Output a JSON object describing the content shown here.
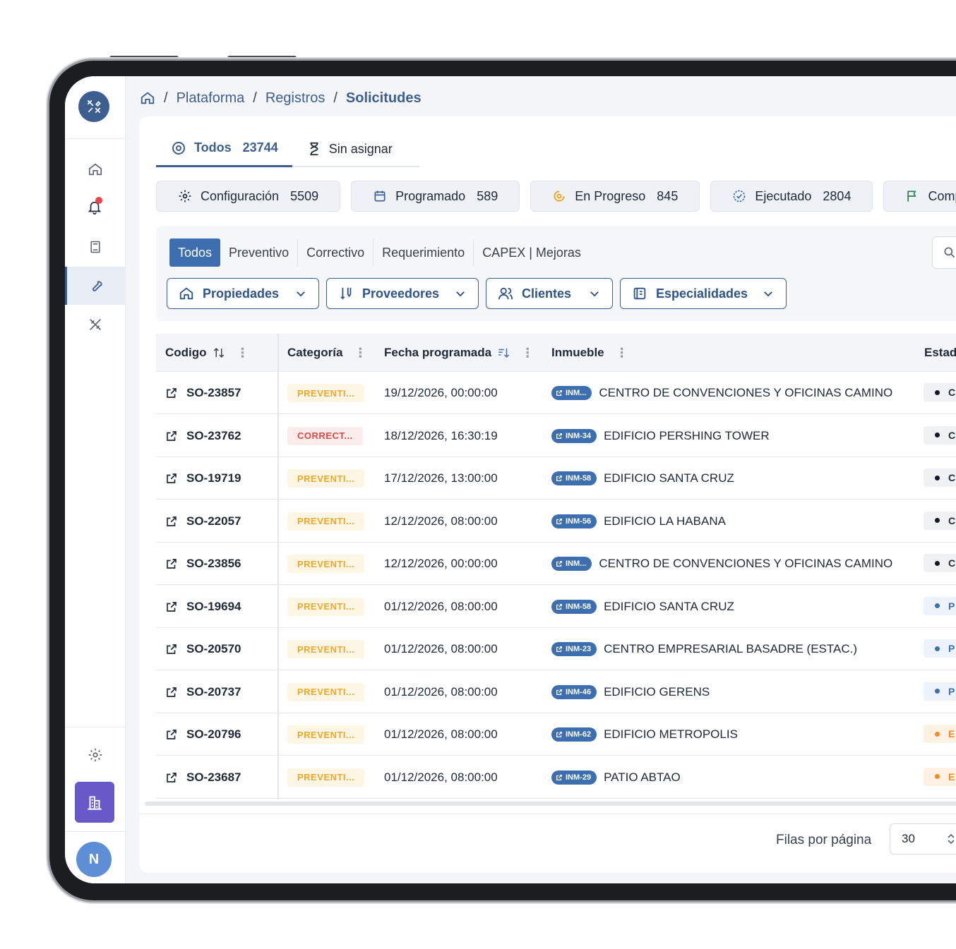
{
  "breadcrumb": {
    "items": [
      "Plataforma",
      "Registros"
    ],
    "current": "Solicitudes"
  },
  "tabs": [
    {
      "label": "Todos",
      "count": "23744"
    },
    {
      "label": "Sin asignar"
    }
  ],
  "status_chips": [
    {
      "label": "Configuración",
      "count": "5509",
      "icon": "gear-icon"
    },
    {
      "label": "Programado",
      "count": "589",
      "icon": "calendar-icon"
    },
    {
      "label": "En Progreso",
      "count": "845",
      "icon": "progress-icon"
    },
    {
      "label": "Ejecutado",
      "count": "2804",
      "icon": "check-circle-icon"
    },
    {
      "label": "Comp",
      "icon": "flag-icon"
    }
  ],
  "segments": [
    "Todos",
    "Preventivo",
    "Correctivo",
    "Requerimiento",
    "CAPEX | Mejoras"
  ],
  "dropdowns": [
    "Propiedades",
    "Proveedores",
    "Clientes",
    "Especialidades"
  ],
  "table": {
    "headers": {
      "code": "Codigo",
      "category": "Categoría",
      "date": "Fecha programada",
      "property": "Inmueble",
      "status": "Estad"
    },
    "rows": [
      {
        "code": "SO-23857",
        "category": "PREVENTI...",
        "cat_type": "prev",
        "date": "19/12/2026, 00:00:00",
        "inm": "INM...",
        "property": "CENTRO DE CONVENCIONES Y OFICINAS CAMINO",
        "state": "C",
        "state_color": "gray"
      },
      {
        "code": "SO-23762",
        "category": "CORRECT...",
        "cat_type": "corr",
        "date": "18/12/2026, 16:30:19",
        "inm": "INM-34",
        "property": "EDIFICIO PERSHING TOWER",
        "state": "C",
        "state_color": "gray"
      },
      {
        "code": "SO-19719",
        "category": "PREVENTI...",
        "cat_type": "prev",
        "date": "17/12/2026, 13:00:00",
        "inm": "INM-58",
        "property": "EDIFICIO SANTA CRUZ",
        "state": "C",
        "state_color": "gray"
      },
      {
        "code": "SO-22057",
        "category": "PREVENTI...",
        "cat_type": "prev",
        "date": "12/12/2026, 08:00:00",
        "inm": "INM-56",
        "property": "EDIFICIO LA HABANA",
        "state": "C",
        "state_color": "gray"
      },
      {
        "code": "SO-23856",
        "category": "PREVENTI...",
        "cat_type": "prev",
        "date": "12/12/2026, 00:00:00",
        "inm": "INM...",
        "property": "CENTRO DE CONVENCIONES Y OFICINAS CAMINO",
        "state": "C",
        "state_color": "gray"
      },
      {
        "code": "SO-19694",
        "category": "PREVENTI...",
        "cat_type": "prev",
        "date": "01/12/2026, 08:00:00",
        "inm": "INM-58",
        "property": "EDIFICIO SANTA CRUZ",
        "state": "P",
        "state_color": "blue"
      },
      {
        "code": "SO-20570",
        "category": "PREVENTI...",
        "cat_type": "prev",
        "date": "01/12/2026, 08:00:00",
        "inm": "INM-23",
        "property": "CENTRO EMPRESARIAL BASADRE (ESTAC.)",
        "state": "P",
        "state_color": "blue"
      },
      {
        "code": "SO-20737",
        "category": "PREVENTI...",
        "cat_type": "prev",
        "date": "01/12/2026, 08:00:00",
        "inm": "INM-46",
        "property": "EDIFICIO GERENS",
        "state": "P",
        "state_color": "blue"
      },
      {
        "code": "SO-20796",
        "category": "PREVENTI...",
        "cat_type": "prev",
        "date": "01/12/2026, 08:00:00",
        "inm": "INM-62",
        "property": "EDIFICIO METROPOLIS",
        "state": "E",
        "state_color": "orange"
      },
      {
        "code": "SO-23687",
        "category": "PREVENTI...",
        "cat_type": "prev",
        "date": "01/12/2026, 08:00:00",
        "inm": "INM-29",
        "property": "PATIO ABTAO",
        "state": "E",
        "state_color": "orange"
      }
    ]
  },
  "pagination": {
    "label": "Filas por página",
    "value": "30"
  },
  "user": {
    "initial": "N"
  },
  "colors": {
    "accent": "#3d5f8f",
    "primary_button": "#3d6fb0",
    "preventive": "#f0a826",
    "corrective": "#e14848"
  }
}
